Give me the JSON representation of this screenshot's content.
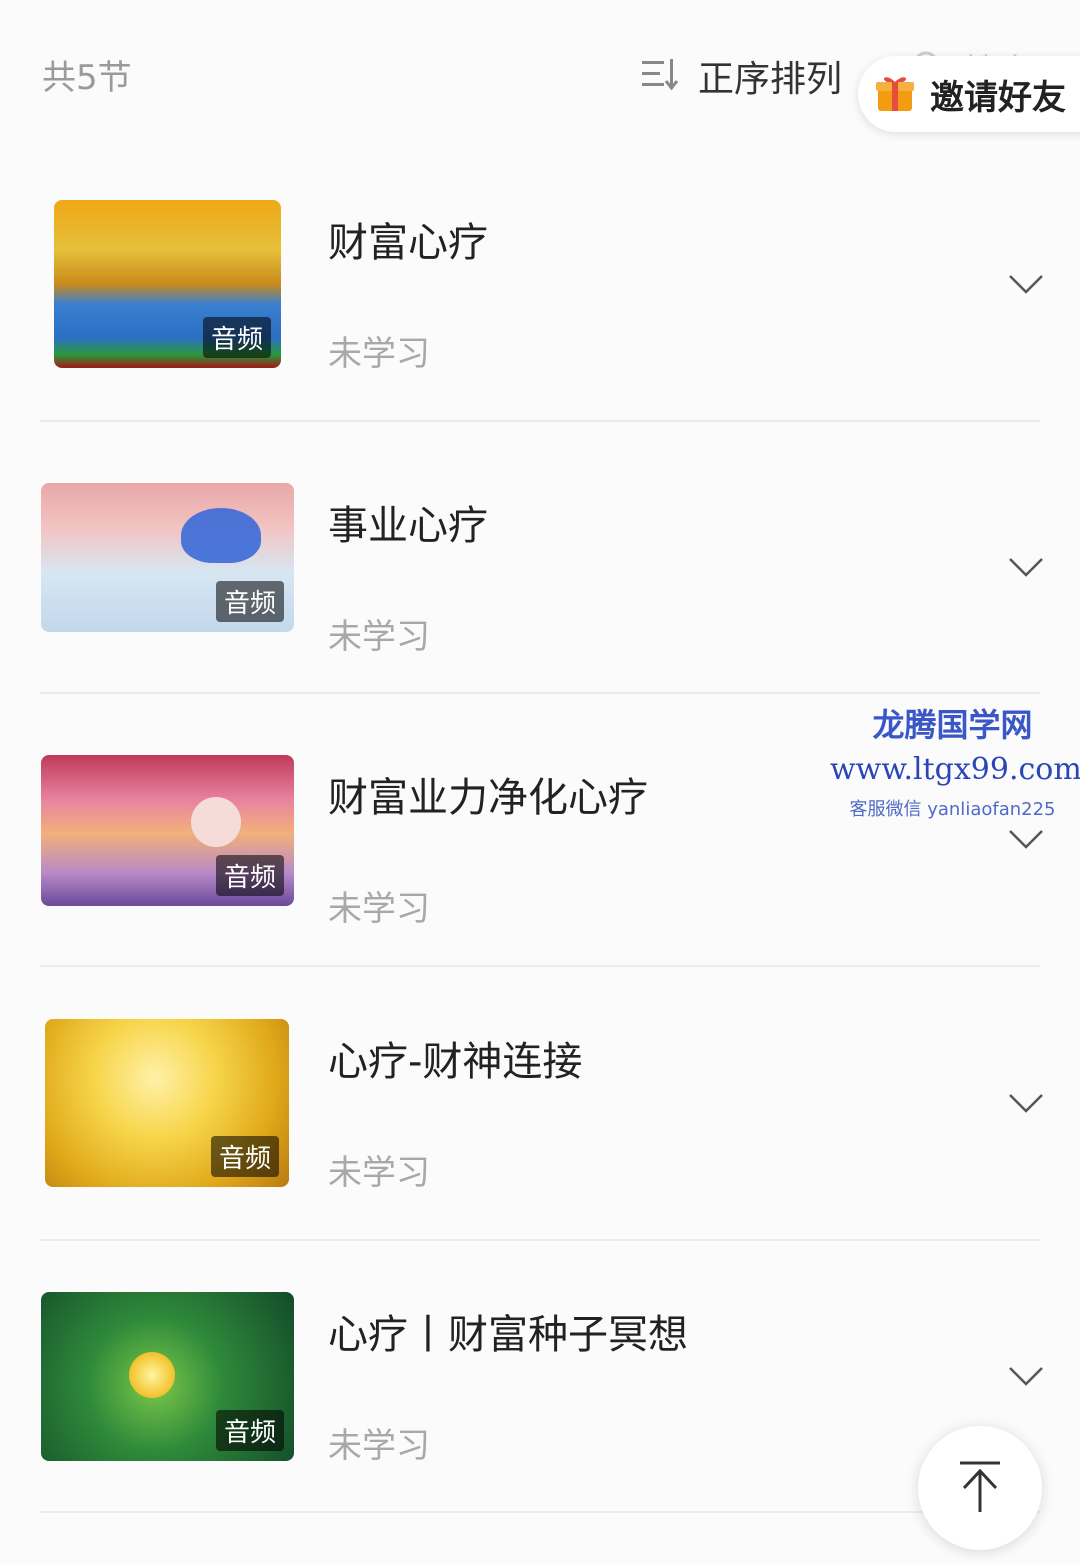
{
  "header": {
    "count_label": "共5节",
    "sort_label": "正序排列",
    "search_label": "搜索",
    "invite_label": "邀请好友"
  },
  "lessons": [
    {
      "title": "财富心疗",
      "badge": "音频",
      "status": "未学习",
      "image": "abstract-golden-sky-painting"
    },
    {
      "title": "事业心疗",
      "badge": "音频",
      "status": "未学习",
      "image": "winged-unicorn-over-water"
    },
    {
      "title": "财富业力净化心疗",
      "badge": "音频",
      "status": "未学习",
      "image": "deer-under-moon-sunset"
    },
    {
      "title": "心疗-财神连接",
      "badge": "音频",
      "status": "未学习",
      "image": "golden-laughing-buddha"
    },
    {
      "title": "心疗丨财富种子冥想",
      "badge": "音频",
      "status": "未学习",
      "image": "glowing-yellow-flower"
    }
  ],
  "watermark": {
    "name": "龙腾国学网",
    "url": "www.ltgx99.com",
    "contact": "客服微信 yanliaofan225"
  },
  "icons": {
    "sort": "sort-icon",
    "search": "search-icon",
    "invite": "gift-icon",
    "expand": "chevron-down-icon",
    "scroll_top": "arrow-up-to-top-icon"
  },
  "colors": {
    "accent_orange": "#f39c12",
    "watermark_blue": "#3a57c8"
  }
}
